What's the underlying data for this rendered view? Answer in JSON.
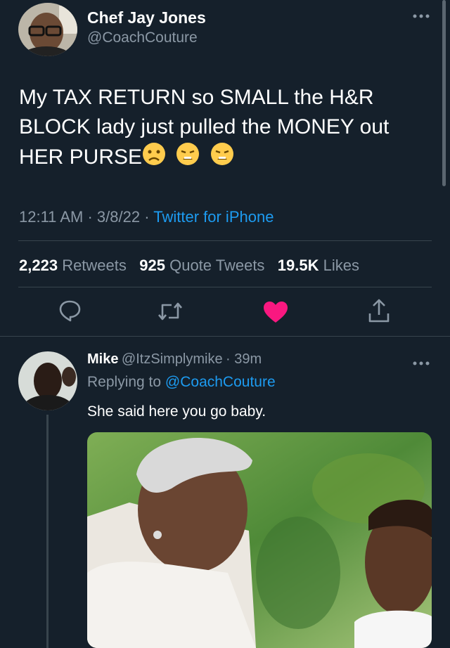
{
  "tweet": {
    "author_name": "Chef Jay Jones",
    "author_handle": "@CoachCouture",
    "text": "My TAX RETURN so SMALL the H&R BLOCK lady just pulled the MONEY out HER PURSE",
    "emojis": [
      "frowning-face-icon",
      "weary-face-icon",
      "weary-face-icon"
    ],
    "time": "12:11 AM",
    "date": "3/8/22",
    "separator": "·",
    "source": "Twitter for iPhone",
    "more_icon": "more-icon",
    "stats": {
      "retweets_count": "2,223",
      "retweets_label": "Retweets",
      "quotes_count": "925",
      "quotes_label": "Quote Tweets",
      "likes_count": "19.5K",
      "likes_label": "Likes"
    },
    "actions": [
      "reply-icon",
      "retweet-icon",
      "like-icon",
      "share-icon"
    ],
    "like_color": "#f91880"
  },
  "reply": {
    "author_name": "Mike",
    "author_handle": "@ItzSimplymike",
    "age": "· 39m",
    "replying_prefix": "Replying to",
    "replying_handle": "@CoachCouture",
    "text": "She said here you go baby."
  },
  "colors": {
    "background": "#15202b",
    "link": "#1d9bf0",
    "secondary_text": "#8b98a5",
    "divider": "#38444d"
  }
}
